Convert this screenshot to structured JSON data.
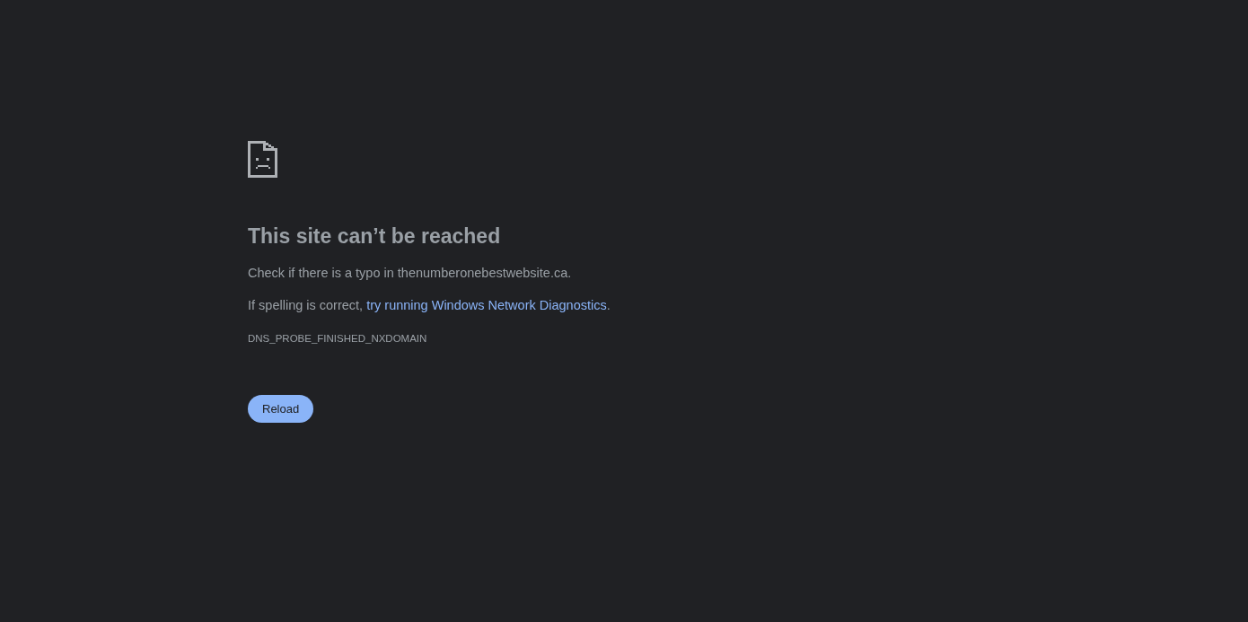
{
  "error_page": {
    "title": "This site can’t be reached",
    "message": "Check if there is a typo in thenumberonebestwebsite.ca.",
    "suggestion": {
      "text": "If spelling is correct, ",
      "link": "try running Windows Network Diagnostics",
      "after": "."
    },
    "error_code": "DNS_PROBE_FINISHED_NXDOMAIN",
    "button": "Reload"
  }
}
